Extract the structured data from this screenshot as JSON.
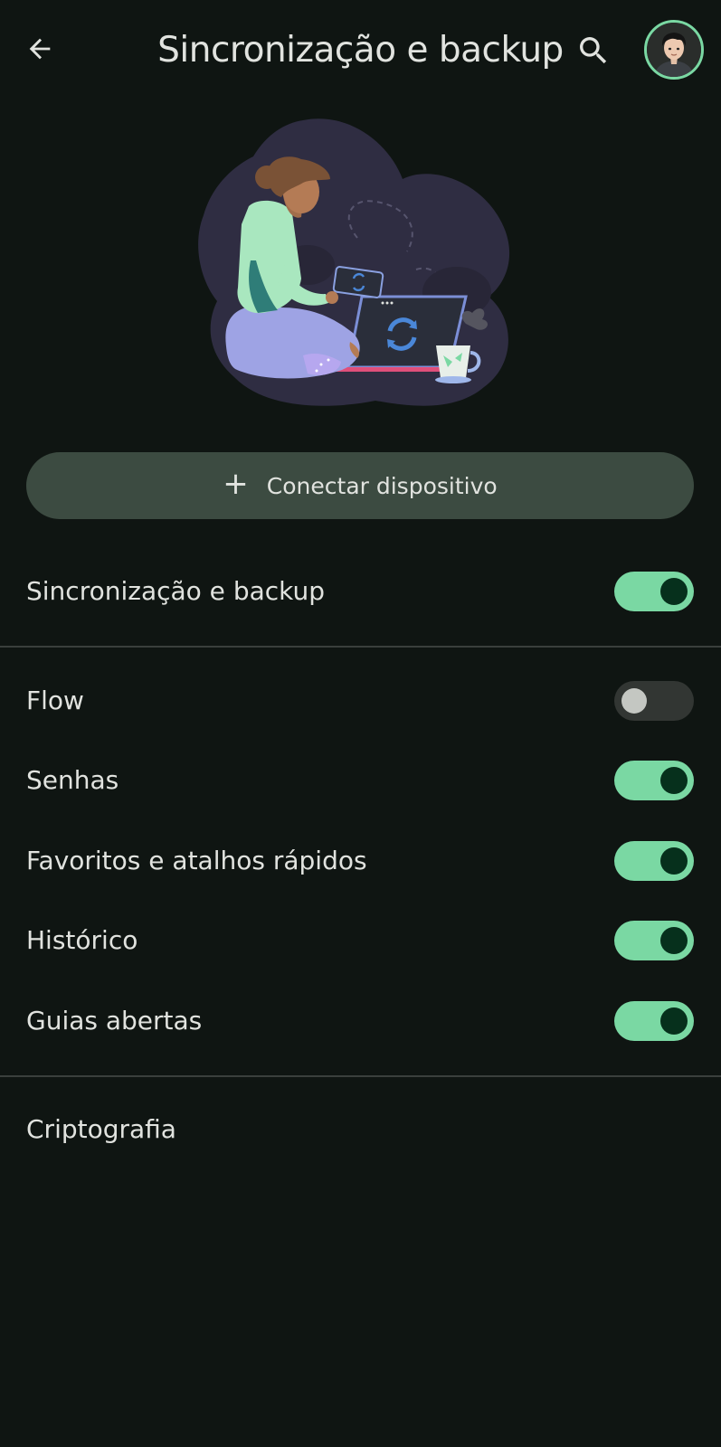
{
  "header": {
    "title": "Sincronização e backup",
    "back_icon": "arrow-back-icon",
    "search_icon": "search-icon",
    "avatar_icon": "user-avatar"
  },
  "illustration": {
    "icon": "sync-illustration"
  },
  "connect_button": {
    "icon": "plus-icon",
    "label": "Conectar dispositivo"
  },
  "main_toggle": {
    "label": "Sincronização e backup",
    "on": true
  },
  "items": [
    {
      "label": "Flow",
      "on": false
    },
    {
      "label": "Senhas",
      "on": true
    },
    {
      "label": "Favoritos e atalhos rápidos",
      "on": true
    },
    {
      "label": "Histórico",
      "on": true
    },
    {
      "label": "Guias abertas",
      "on": true
    }
  ],
  "encryption": {
    "label": "Criptografia"
  },
  "colors": {
    "background": "#0f1512",
    "accent": "#7ad8a3",
    "button_bg": "#3c4b41",
    "text": "#e1e3df"
  }
}
